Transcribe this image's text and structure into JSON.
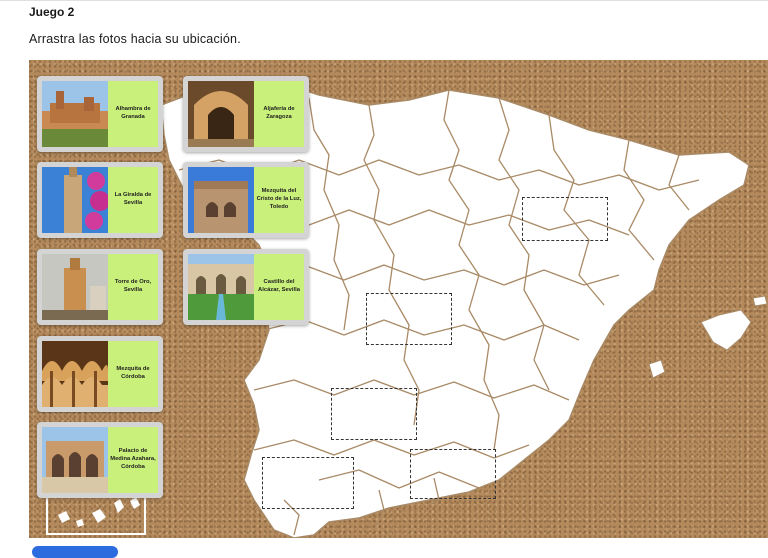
{
  "header": {
    "title": "Juego 2",
    "instructions": "Arrastra las fotos hacia su ubicación."
  },
  "cards": [
    {
      "id": "alhambra",
      "label": "Alhambra de Granada",
      "photo_icon": "alhambra-photo"
    },
    {
      "id": "giralda",
      "label": "La Giralda de Sevilla",
      "photo_icon": "giralda-photo"
    },
    {
      "id": "torre-oro",
      "label": "Torre de Oro, Sevilla",
      "photo_icon": "torre-oro-photo"
    },
    {
      "id": "mezquita-cordoba",
      "label": "Mezquita de Córdoba",
      "photo_icon": "mezquita-photo"
    },
    {
      "id": "medina-azahara",
      "label": "Palacio de Medina Azahara, Córdoba",
      "photo_icon": "medina-azahara-photo"
    },
    {
      "id": "aljaferia",
      "label": "Aljafería de Zaragoza",
      "photo_icon": "aljaferia-photo"
    },
    {
      "id": "cristo-luz",
      "label": "Mezquita del Cristo de la Luz, Toledo",
      "photo_icon": "cristo-luz-photo"
    },
    {
      "id": "alcazar",
      "label": "Castillo del Alcázar, Sevilla",
      "photo_icon": "alcazar-photo"
    }
  ],
  "colors": {
    "label_bg": "#c8f07a",
    "board": "#b48a5c",
    "map_fill": "#ffffff",
    "map_border": "#a98a66",
    "button": "#2d6cdf"
  }
}
